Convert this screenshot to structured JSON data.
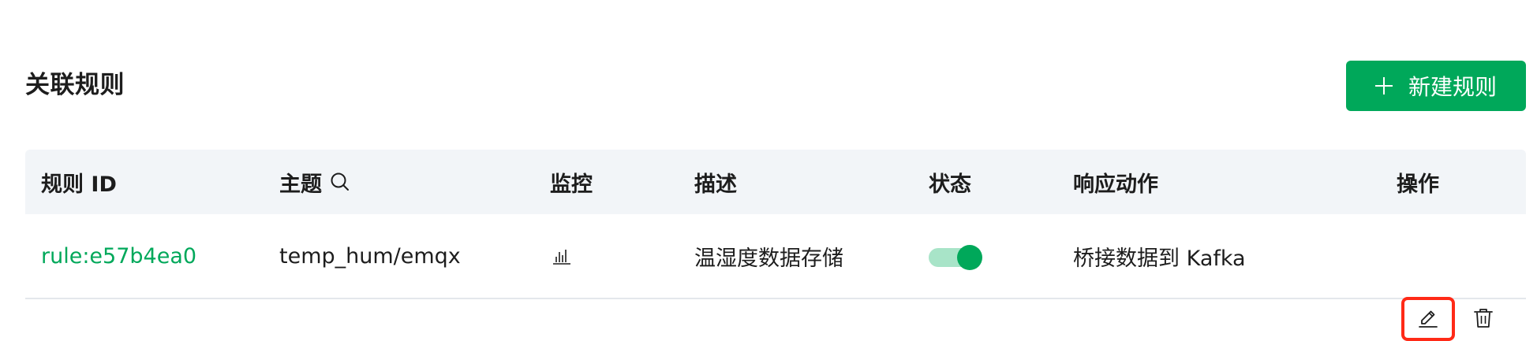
{
  "section": {
    "title": "关联规则"
  },
  "actions": {
    "add_rule_label": "新建规则"
  },
  "table": {
    "headers": {
      "rule_id": "规则 ID",
      "topic": "主题",
      "monitor": "监控",
      "description": "描述",
      "status": "状态",
      "response_action": "响应动作",
      "operation": "操作"
    },
    "rows": [
      {
        "rule_id": "rule:e57b4ea0",
        "topic": "temp_hum/emqx",
        "description": "温湿度数据存储",
        "status_enabled": true,
        "response_action": "桥接数据到 Kafka"
      }
    ]
  },
  "colors": {
    "accent": "#00a85a",
    "highlight": "#ff2a17",
    "header_bg": "#f2f5f8"
  },
  "icons": {
    "topic_search": "search-icon",
    "monitor": "bar-chart-icon",
    "edit": "edit-pencil-icon",
    "delete": "trash-icon",
    "add": "plus-icon"
  }
}
